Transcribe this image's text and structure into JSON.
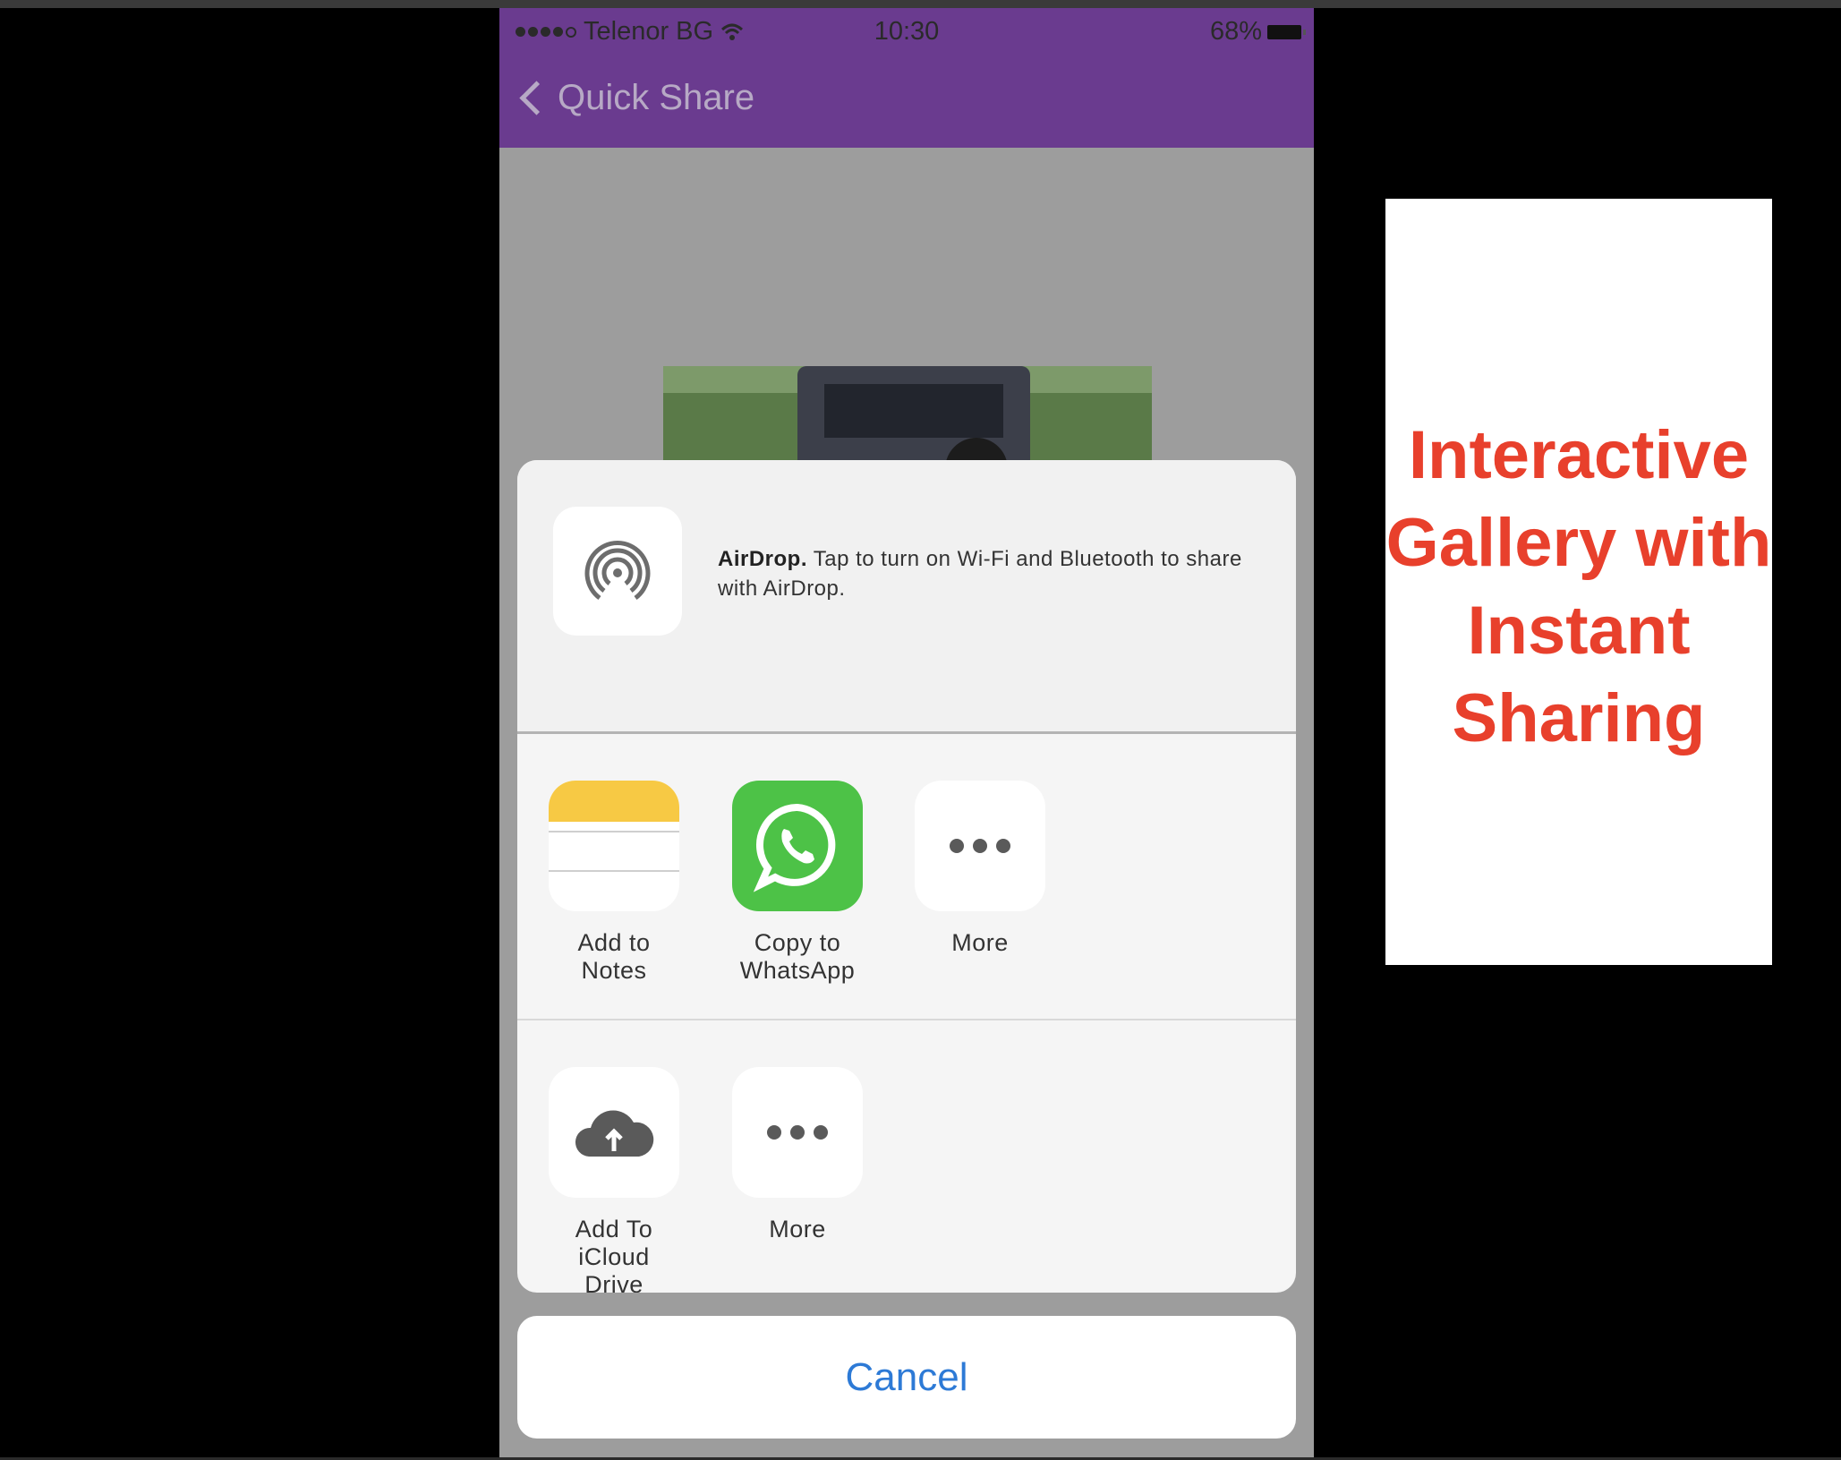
{
  "status_bar": {
    "carrier": "Telenor BG",
    "time": "10:30",
    "battery": "68%"
  },
  "nav": {
    "back_label": "Quick Share"
  },
  "airdrop": {
    "title": "AirDrop.",
    "description": "Tap to turn on Wi-Fi and Bluetooth to share with AirDrop."
  },
  "share_row": [
    {
      "label": "Add to Notes",
      "icon": "notes-icon"
    },
    {
      "label": "Copy to WhatsApp",
      "icon": "whatsapp-icon"
    },
    {
      "label": "More",
      "icon": "more-icon"
    }
  ],
  "action_row": [
    {
      "label": "Add To iCloud Drive",
      "icon": "icloud-upload-icon"
    },
    {
      "label": "More",
      "icon": "more-icon"
    }
  ],
  "cancel_label": "Cancel",
  "promo": {
    "title_line1": "Interactive",
    "title_line2": "Gallery with",
    "title_line3": "Instant",
    "title_line4": "Sharing"
  },
  "colors": {
    "nav_purple": "#6a3b8f",
    "cancel_blue": "#2d7ad6",
    "promo_red": "#e8402c",
    "whatsapp_green": "#4dc247",
    "notes_yellow": "#f7c944"
  }
}
